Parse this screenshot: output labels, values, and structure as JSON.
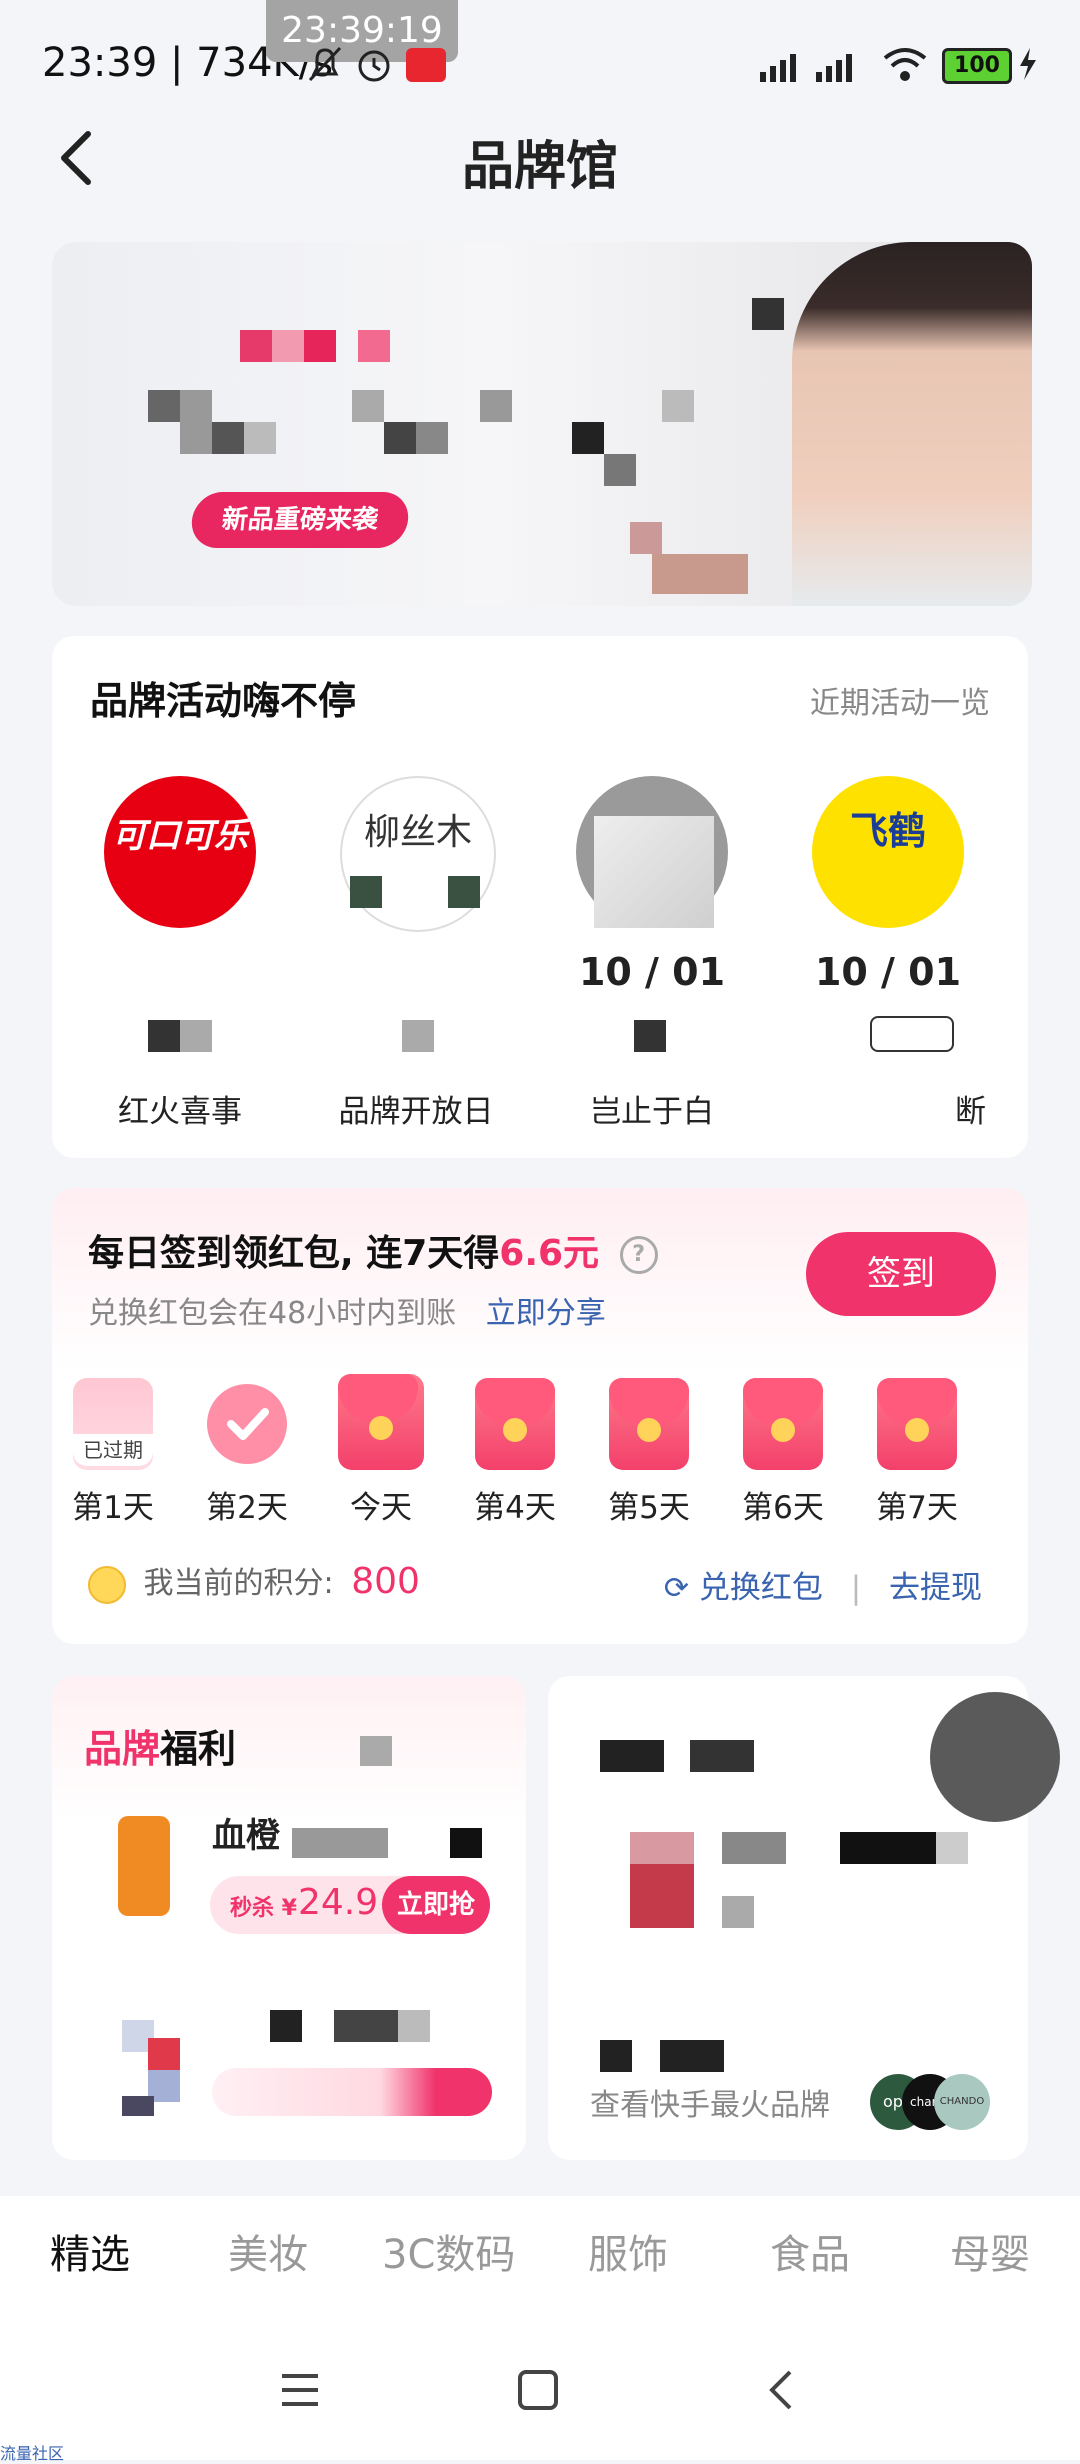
{
  "status_bar": {
    "time": "23:39 | 734K/s",
    "toast_time": "23:39:19",
    "battery": "100"
  },
  "header": {
    "title": "品牌馆"
  },
  "banner": {
    "tag": "新品重磅来袭"
  },
  "activities": {
    "title": "品牌活动嗨不停",
    "link": "近期活动一览",
    "brands": [
      {
        "logo_text": "可口可乐",
        "date": "",
        "name": "红火喜事",
        "color": "#e60012"
      },
      {
        "logo_text": "柳丝木",
        "date": "",
        "name": "品牌开放日",
        "color": "#ffffff"
      },
      {
        "logo_text": "",
        "date": "10 / 01",
        "name": "岂止于白",
        "color": "#9a9a9a"
      },
      {
        "logo_text": "飞鹤",
        "date": "10 / 01",
        "name": "断",
        "color": "#ffe100"
      }
    ]
  },
  "checkin": {
    "title_prefix": "每日签到领红包, 连7天得",
    "title_amount": "6.6元",
    "subtitle": "兑换红包会在48小时内到账",
    "share": "立即分享",
    "button": "签到",
    "expired_label": "已过期",
    "days": [
      "第1天",
      "第2天",
      "今天",
      "第4天",
      "第5天",
      "第6天",
      "第7天"
    ],
    "points_label": "我当前的积分:",
    "points_value": "800",
    "exchange": "兑换红包",
    "withdraw": "去提现"
  },
  "welfare": {
    "title_a": "品牌",
    "title_b": "福利",
    "product1_name": "血橙",
    "product1_price_prefix": "秒杀 ¥",
    "product1_price": "24.9",
    "product1_buy": "立即抢",
    "hot_brands": "查看快手最火品牌",
    "hot_brand_logos": [
      "opp",
      "chanel",
      "CHANDO"
    ]
  },
  "category_tabs": [
    "精选",
    "美妆",
    "3C数码",
    "服饰",
    "食品",
    "母婴"
  ],
  "footer_mark": "流量社区",
  "colors": {
    "accent": "#f0336a",
    "blue_link": "#3a63b0"
  }
}
